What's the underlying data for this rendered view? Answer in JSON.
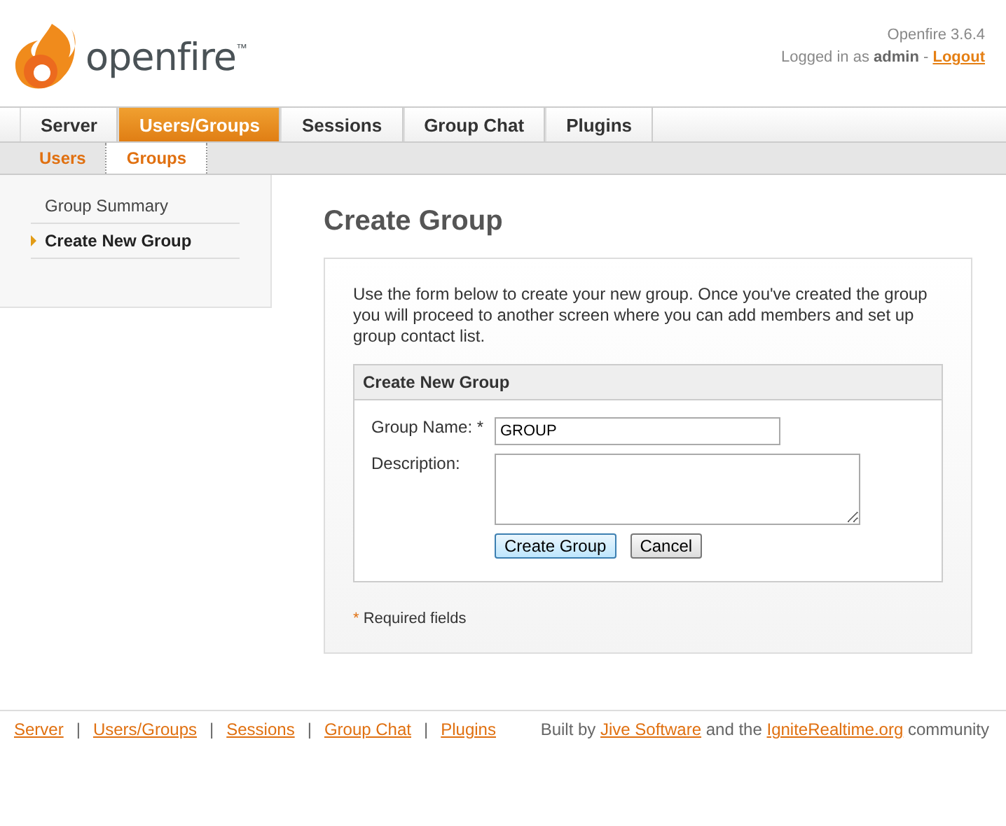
{
  "header": {
    "logo_text": "openfire",
    "trademark": "™",
    "version": "Openfire 3.6.4",
    "logged_in_prefix": "Logged in as",
    "user": "admin",
    "separator": "-",
    "logout": "Logout"
  },
  "tabs": [
    {
      "label": "Server",
      "selected": false
    },
    {
      "label": "Users/Groups",
      "selected": true
    },
    {
      "label": "Sessions",
      "selected": false
    },
    {
      "label": "Group Chat",
      "selected": false
    },
    {
      "label": "Plugins",
      "selected": false
    }
  ],
  "subtabs": [
    {
      "label": "Users",
      "selected": false
    },
    {
      "label": "Groups",
      "selected": true
    }
  ],
  "sidebar": {
    "items": [
      {
        "label": "Group Summary",
        "selected": false
      },
      {
        "label": "Create New Group",
        "selected": true
      }
    ]
  },
  "main": {
    "title": "Create Group",
    "intro": "Use the form below to create your new group. Once you've created the group you will proceed to another screen where you can add members and set up group contact list.",
    "form": {
      "title": "Create New Group",
      "group_name_label": "Group Name: *",
      "group_name_value": "GROUP",
      "description_label": "Description:",
      "buttons": [
        {
          "label": "Create Group",
          "kind": "primary"
        },
        {
          "label": "Cancel",
          "kind": "secondary"
        }
      ]
    },
    "required_note_mark": "*",
    "required_note": "Required fields"
  },
  "footer": {
    "links": [
      "Server",
      "Users/Groups",
      "Sessions",
      "Group Chat",
      "Plugins"
    ],
    "divider": "|",
    "credit": {
      "prefix": "Built by",
      "link1": "Jive Software",
      "middle": "and the",
      "link2": "IgniteRealtime.org",
      "suffix": "community"
    }
  }
}
